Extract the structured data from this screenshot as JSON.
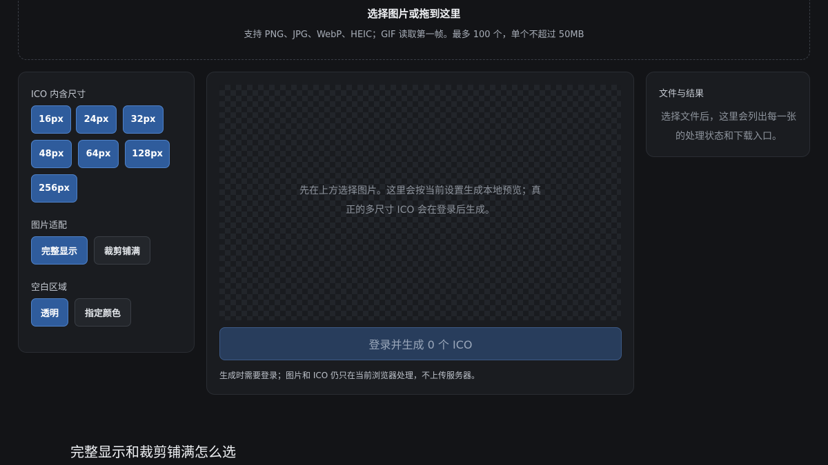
{
  "dropzone": {
    "title": "选择图片或拖到这里",
    "hint": "支持 PNG、JPG、WebP、HEIC；GIF 读取第一帧。最多 100 个，单个不超过 50MB"
  },
  "settings": {
    "sizes_label": "ICO 内含尺寸",
    "sizes": [
      {
        "label": "16px",
        "selected": true
      },
      {
        "label": "24px",
        "selected": true
      },
      {
        "label": "32px",
        "selected": true
      },
      {
        "label": "48px",
        "selected": true
      },
      {
        "label": "64px",
        "selected": true
      },
      {
        "label": "128px",
        "selected": true
      },
      {
        "label": "256px",
        "selected": true
      }
    ],
    "fit_label": "图片适配",
    "fit_options": [
      {
        "label": "完整显示",
        "selected": true
      },
      {
        "label": "裁剪铺满",
        "selected": false
      }
    ],
    "blank_label": "空白区域",
    "blank_options": [
      {
        "label": "透明",
        "selected": true
      },
      {
        "label": "指定颜色",
        "selected": false
      }
    ]
  },
  "preview": {
    "placeholder": "先在上方选择图片。这里会按当前设置生成本地预览；真正的多尺寸 ICO 会在登录后生成。",
    "generate_button": "登录并生成 0 个 ICO",
    "note": "生成时需要登录；图片和 ICO 仍只在当前浏览器处理，不上传服务器。"
  },
  "files": {
    "title": "文件与结果",
    "empty": "选择文件后，这里会列出每一张的处理状态和下载入口。"
  },
  "bottom_heading": "完整显示和裁剪铺满怎么选",
  "colors": {
    "background": "#131417",
    "panel": "#1a1c20",
    "accent": "#2f5c9c",
    "accent_border": "#4f82c9"
  }
}
